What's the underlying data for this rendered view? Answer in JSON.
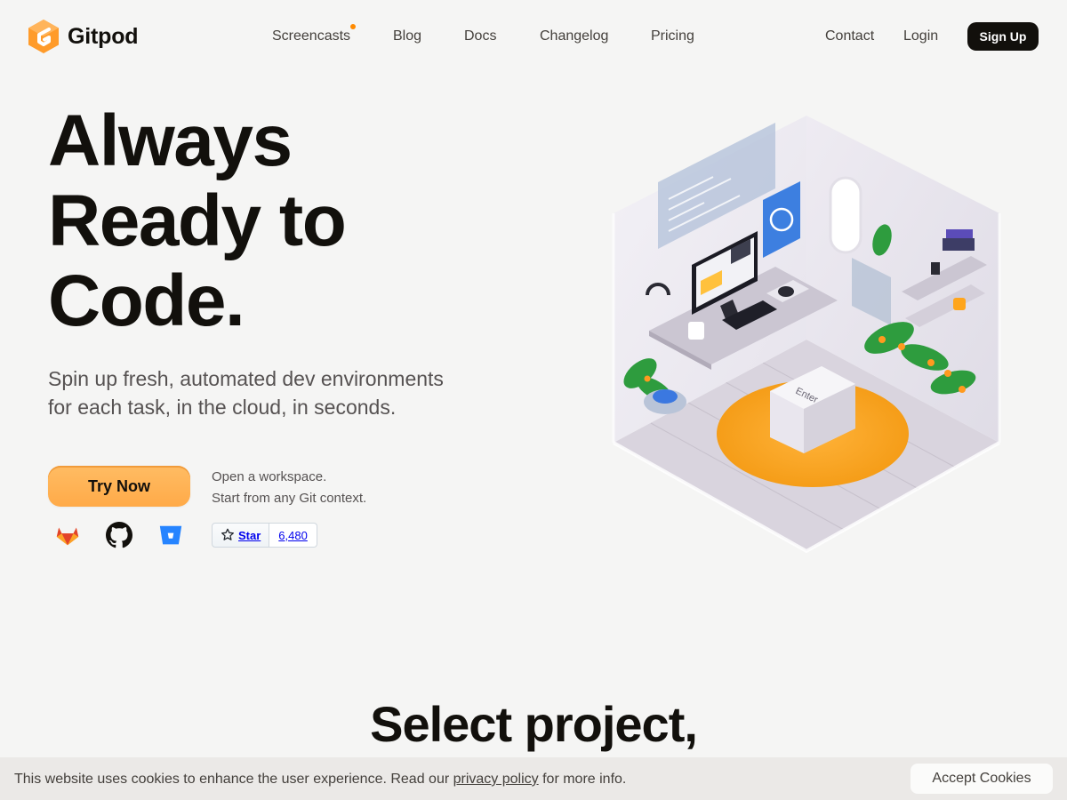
{
  "brand": {
    "name": "Gitpod",
    "accent": "#ffb45b",
    "dark": "#12100c",
    "dot": "#ff8a00"
  },
  "nav": {
    "items": [
      {
        "label": "Screencasts",
        "has_dot": true
      },
      {
        "label": "Blog"
      },
      {
        "label": "Docs"
      },
      {
        "label": "Changelog"
      },
      {
        "label": "Pricing"
      }
    ],
    "contact": "Contact",
    "login": "Login",
    "signup": "Sign Up"
  },
  "hero": {
    "title_lines": [
      "Always",
      "Ready to",
      "Code."
    ],
    "subtitle_lines": [
      "Spin up fresh, automated dev environments",
      "for each task, in the cloud, in seconds."
    ],
    "cta": "Try Now",
    "workspace_lines": [
      "Open a workspace.",
      "Start from any Git context."
    ],
    "git_providers": [
      "gitlab-icon",
      "github-icon",
      "bitbucket-icon"
    ],
    "github_star": {
      "label": "Star",
      "count": "6,480"
    }
  },
  "illustration": {
    "enter_key_label": "Enter"
  },
  "section": {
    "title": "Select project,"
  },
  "cookie": {
    "text_before": "This website uses cookies to enhance the user experience. Read our ",
    "link": "privacy policy",
    "text_after": " for more info.",
    "accept": "Accept Cookies"
  }
}
